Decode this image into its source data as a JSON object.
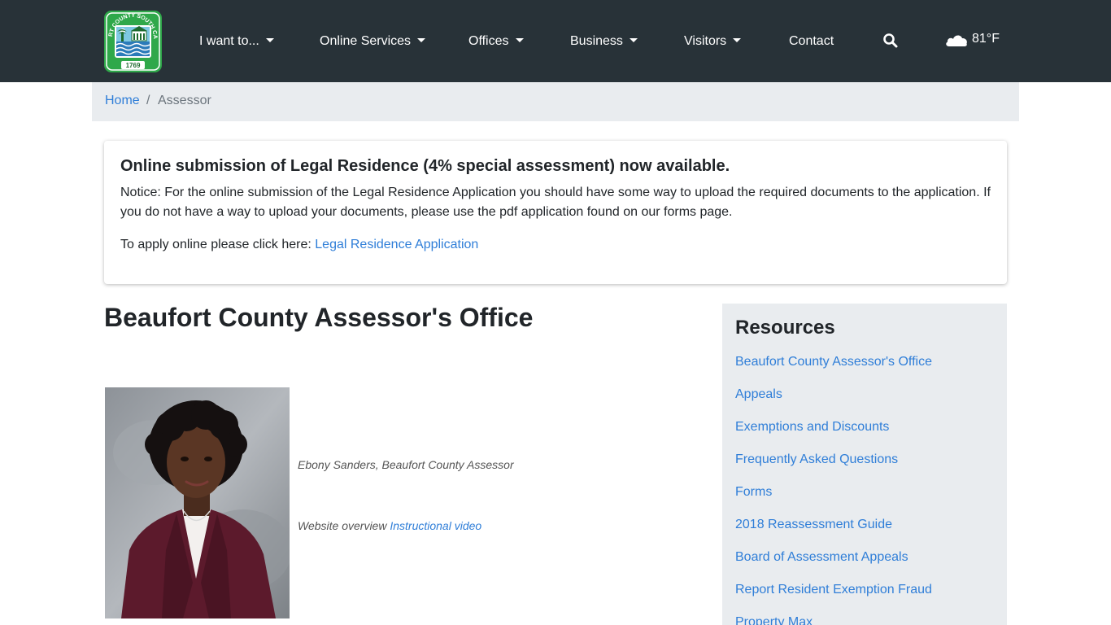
{
  "header": {
    "logo": {
      "top_text": "BEAUFORT COUNTY SOUTH CAROLINA",
      "year": "1769"
    },
    "nav": [
      {
        "label": "I want to...",
        "dropdown": true
      },
      {
        "label": "Online Services",
        "dropdown": true
      },
      {
        "label": "Offices",
        "dropdown": true
      },
      {
        "label": "Business",
        "dropdown": true
      },
      {
        "label": "Visitors",
        "dropdown": true
      },
      {
        "label": "Contact",
        "dropdown": false
      }
    ],
    "search_icon": "search-icon",
    "weather": {
      "icon": "cloud-icon",
      "temperature": "81°F"
    }
  },
  "breadcrumb": {
    "home": "Home",
    "separator": "/",
    "current": "Assessor"
  },
  "notice": {
    "title": "Online submission of Legal Residence (4% special assessment) now available.",
    "text": "Notice: For the online submission of the Legal Residence Application you should have some way to upload the required documents to the application. If you do not have a way to upload your documents, please use the pdf application found on our forms page.",
    "apply_prefix": "To apply online please click here:",
    "apply_link": "Legal Residence Application"
  },
  "main": {
    "title": "Beaufort County Assessor's Office",
    "photo_caption": "Ebony Sanders, Beaufort County Assessor",
    "overview_prefix": "Website overview",
    "overview_link": "Instructional video"
  },
  "sidebar": {
    "title": "Resources",
    "links": [
      "Beaufort County Assessor's Office",
      "Appeals",
      "Exemptions and Discounts",
      "Frequently Asked Questions",
      "Forms",
      "2018 Reassessment Guide",
      "Board of Assessment Appeals",
      "Report Resident Exemption Fraud",
      "Property Max"
    ]
  },
  "colors": {
    "navbar": "#283238",
    "link": "#2f7ed8",
    "breadcrumb_bg": "#e9ecef",
    "sidebar_bg": "#e9ecef"
  }
}
